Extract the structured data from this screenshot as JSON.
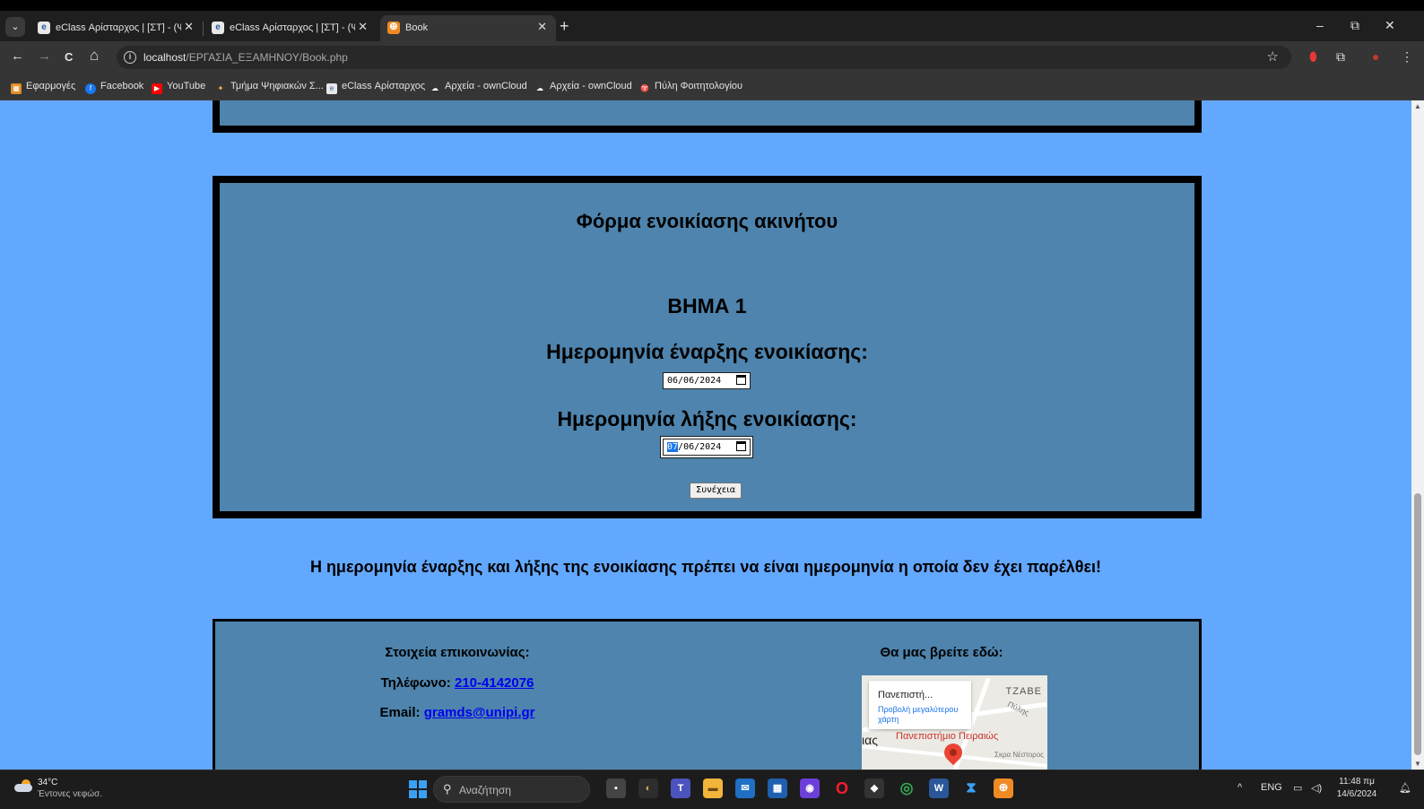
{
  "browser": {
    "tabs": [
      {
        "title": "eClass Αρίσταρχος | [ΣΤ] - (ΨΣ-",
        "close": "✕"
      },
      {
        "title": "eClass Αρίσταρχος | [ΣΤ] - (ΨΣ-",
        "close": "✕"
      },
      {
        "title": "Book",
        "close": "✕"
      }
    ],
    "new_tab": "+",
    "window_controls": {
      "minimize": "–",
      "restore": "⧉",
      "close": "✕"
    },
    "nav": {
      "back": "←",
      "forward": "→",
      "reload": "C",
      "home": "⌂"
    },
    "url_host": "localhost",
    "url_path": "/ΕΡΓΑΣΙΑ_ΕΞΑΜΗΝΟΥ/Book.php",
    "bookmarks": [
      "Εφαρμογές",
      "Facebook",
      "YouTube",
      "Τμήμα Ψηφιακών Σ...",
      "eClass Αρίσταρχος",
      "Αρχεία - ownCloud",
      "Αρχεία - ownCloud",
      "Πύλη Φοιτητολογίου"
    ]
  },
  "page": {
    "form_title": "Φόρμα ενοικίασης ακινήτου",
    "step": "ΒΗΜΑ 1",
    "start_label": "Ημερομηνία έναρξης ενοικίασης:",
    "start_date": "06/06/2024",
    "end_label": "Ημερομηνία λήξης ενοικίασης:",
    "end_date_day": "07",
    "end_date_rest": "/06/2024",
    "continue_button": "Συνέχεια",
    "warning": "Η ημερομηνία έναρξης και λήξης της ενοικίασης πρέπει να είναι ημερομηνία η οποία δεν έχει παρέλθει!",
    "footer": {
      "contact_title": "Στοιχεία επικοινωνίας:",
      "phone_label": "Τηλέφωνο:",
      "phone": "210-4142076",
      "email_label": "Email:",
      "email": "gramds@unipi.gr",
      "map_title": "Θα μας βρείτε εδώ:",
      "map_popup_title": "Πανεπιστή...",
      "map_popup_link": "Προβολή μεγαλύτερου χάρτη",
      "map_labels": {
        "district": "ΤΖΑΒΕ",
        "street": "Πύλης",
        "university": "Πανεπιστήμιο Πειραιώς",
        "partial": "ιας",
        "other": "Σκρα Νέστορος"
      }
    }
  },
  "taskbar": {
    "temperature": "34°C",
    "weather": "Έντονες νεφώσ.",
    "search_placeholder": "Αναζήτηση",
    "lang": "ENG",
    "time": "11:48 πμ",
    "date": "14/6/2024"
  },
  "colors": {
    "page_bg": "#63a8ff",
    "panel_bg": "#4e84ad",
    "link": "#0000ee"
  }
}
